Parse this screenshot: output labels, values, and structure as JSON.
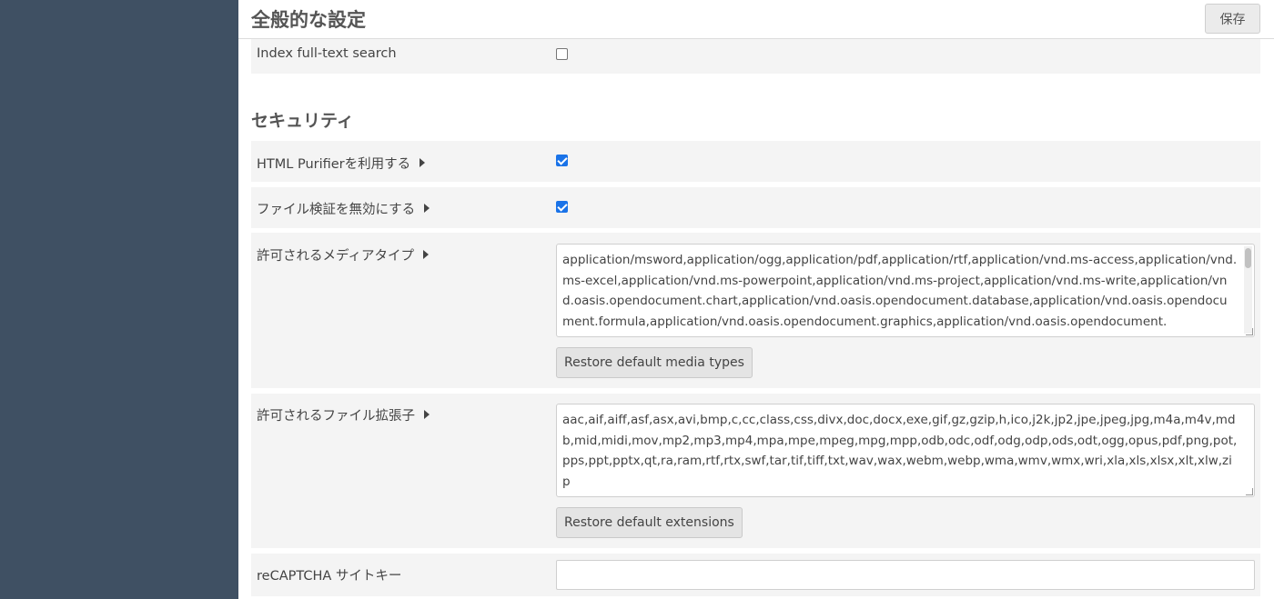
{
  "header": {
    "title": "全般的な設定",
    "save_label": "保存"
  },
  "rows": {
    "index_search": {
      "label": "Index full-text search",
      "checked": false
    },
    "html_purifier": {
      "label": "HTML Purifierを利用する",
      "checked": true
    },
    "disable_file_validation": {
      "label": "ファイル検証を無効にする",
      "checked": true
    },
    "media_types": {
      "label": "許可されるメディアタイプ",
      "value": "application/msword,application/ogg,application/pdf,application/rtf,application/vnd.ms-access,application/vnd.ms-excel,application/vnd.ms-powerpoint,application/vnd.ms-project,application/vnd.ms-write,application/vnd.oasis.opendocument.chart,application/vnd.oasis.opendocument.database,application/vnd.oasis.opendocument.formula,application/vnd.oasis.opendocument.graphics,application/vnd.oasis.opendocument.",
      "restore_label": "Restore default media types"
    },
    "file_extensions": {
      "label": "許可されるファイル拡張子",
      "value": "aac,aif,aiff,asf,asx,avi,bmp,c,cc,class,css,divx,doc,docx,exe,gif,gz,gzip,h,ico,j2k,jp2,jpe,jpeg,jpg,m4a,m4v,mdb,mid,midi,mov,mp2,mp3,mp4,mpa,mpe,mpeg,mpg,mpp,odb,odc,odf,odg,odp,ods,odt,ogg,opus,pdf,png,pot,pps,ppt,pptx,qt,ra,ram,rtf,rtx,swf,tar,tif,tiff,txt,wav,wax,webm,webp,wma,wmv,wmx,wri,xla,xls,xlsx,xlt,xlw,zip",
      "restore_label": "Restore default extensions"
    },
    "recaptcha_site_key": {
      "label": "reCAPTCHA サイトキー",
      "value": ""
    }
  },
  "sections": {
    "security": "セキュリティ"
  },
  "colors": {
    "sidebar": "#3f5063",
    "row_background": "#f4f4f4",
    "checkbox_checked": "#1a73e8"
  }
}
